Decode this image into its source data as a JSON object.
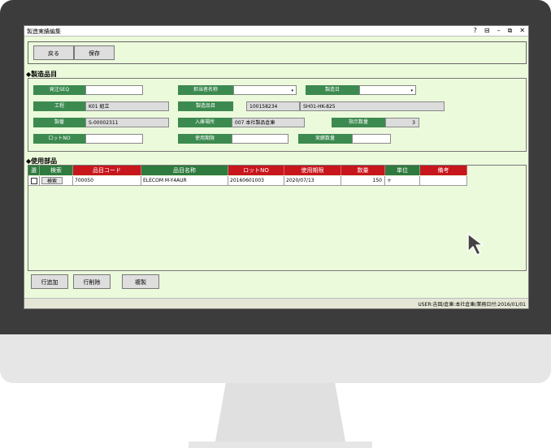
{
  "window": {
    "title": "製造実績編集",
    "controls": {
      "help": "?",
      "restore_small": "⊟",
      "minimize": "–",
      "maximize": "⧉",
      "close": "✕"
    }
  },
  "toolbar": {
    "back_label": "戻る",
    "save_label": "保存"
  },
  "manufactured_item": {
    "section_title": "◆製造品目",
    "order_seq_label": "発注SEQ",
    "order_seq_value": "",
    "staff_label": "担当者名称",
    "staff_value": "",
    "mfg_date_label": "製造日",
    "mfg_date_value": "",
    "process_label": "工程",
    "process_value": "K01 組立",
    "mfg_item_label": "製造品目",
    "mfg_item_code": "100158234",
    "mfg_item_name": "SH01-HK-825",
    "serial_label": "製番",
    "serial_value": "S-00002311",
    "storage_label": "入庫場所",
    "storage_value": "007 本社製品倉庫",
    "instructed_qty_label": "指示数量",
    "instructed_qty_value": "3",
    "lot_label": "ロットNO",
    "lot_value": "",
    "expiry_label": "使用期限",
    "expiry_value": "",
    "actual_qty_label": "実績数量",
    "actual_qty_value": ""
  },
  "parts": {
    "section_title": "◆使用部品",
    "columns": [
      "選",
      "検索",
      "品目コード",
      "品目名称",
      "ロットNO",
      "使用期限",
      "数量",
      "単位",
      "備考"
    ],
    "rows": [
      {
        "search_label": "検索",
        "code": "700050",
        "name": "ELECOM M-Y4AUR",
        "lot": "20160601003",
        "expiry": "2020/07/13",
        "qty": "150",
        "unit": "ヶ",
        "note": ""
      }
    ]
  },
  "row_buttons": {
    "add_label": "行追加",
    "delete_label": "行削除",
    "copy_label": "複製"
  },
  "status_bar": {
    "text": "USER:吉田/倉庫:本社倉庫/業務日付:2016/01/01"
  },
  "icons": {
    "cursor": "mouse-pointer-icon",
    "dropdown": "chevron-down-icon",
    "checkbox": "checkbox-icon"
  },
  "colors": {
    "label_green": "#3c8a50",
    "header_red": "#c8161d",
    "background": "#ecfadc"
  }
}
